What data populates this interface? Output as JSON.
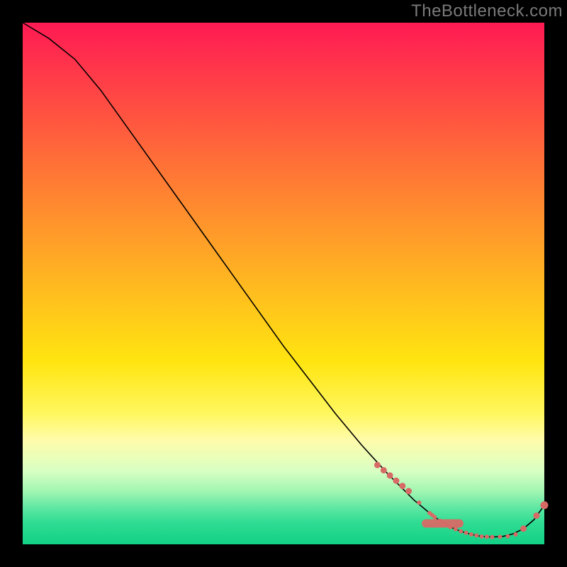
{
  "watermark": "TheBottleneck.com",
  "chart_data": {
    "type": "line",
    "title": "",
    "xlabel": "",
    "ylabel": "",
    "xlim": [
      0,
      100
    ],
    "ylim": [
      0,
      100
    ],
    "grid": false,
    "legend": false,
    "series": [
      {
        "name": "bottleneck-curve",
        "x": [
          0,
          5,
          10,
          15,
          20,
          25,
          30,
          35,
          40,
          45,
          50,
          55,
          60,
          65,
          70,
          72,
          75,
          78,
          80,
          82,
          84,
          86,
          88,
          90,
          92,
          94,
          96,
          98,
          100
        ],
        "y": [
          100,
          97,
          93,
          87,
          80,
          73,
          66,
          59,
          52,
          45,
          38,
          31.5,
          25,
          19,
          13.5,
          11.5,
          8.5,
          6,
          4.5,
          3.3,
          2.5,
          1.9,
          1.5,
          1.4,
          1.5,
          2.0,
          3.0,
          4.7,
          7.5
        ]
      }
    ],
    "highlight_markers": {
      "name": "optimal-range-markers",
      "x": [
        68,
        69.2,
        70.4,
        71.6,
        72.8,
        74,
        76,
        78,
        78.5,
        79,
        80,
        81,
        82,
        83,
        84,
        85,
        86,
        87,
        88,
        89,
        90,
        91.5,
        93,
        94.5,
        96,
        98.5,
        100
      ],
      "y": [
        15.2,
        14.2,
        13.2,
        12.2,
        11.2,
        10.2,
        8.0,
        6.0,
        5.6,
        5.2,
        4.5,
        3.9,
        3.3,
        2.9,
        2.5,
        2.2,
        1.9,
        1.7,
        1.5,
        1.45,
        1.4,
        1.45,
        1.55,
        1.9,
        3.0,
        5.5,
        7.5
      ],
      "r": [
        4,
        4,
        4,
        4,
        4,
        4,
        2.5,
        2.5,
        2.5,
        2.5,
        2.5,
        2.5,
        2.5,
        2.5,
        2.5,
        2.5,
        2.5,
        2.5,
        2.5,
        2.5,
        2.5,
        2.5,
        2.5,
        2.5,
        4,
        4,
        5
      ]
    },
    "label_marker": {
      "name": "series-label",
      "x": 80.5,
      "y": 4.0,
      "w": 8,
      "h": 1.6
    },
    "colors": {
      "curve": "#000000",
      "markers": "#d86a66",
      "gradient_top": "#ff1a53",
      "gradient_mid": "#ffe510",
      "gradient_bottom": "#12d186"
    }
  }
}
